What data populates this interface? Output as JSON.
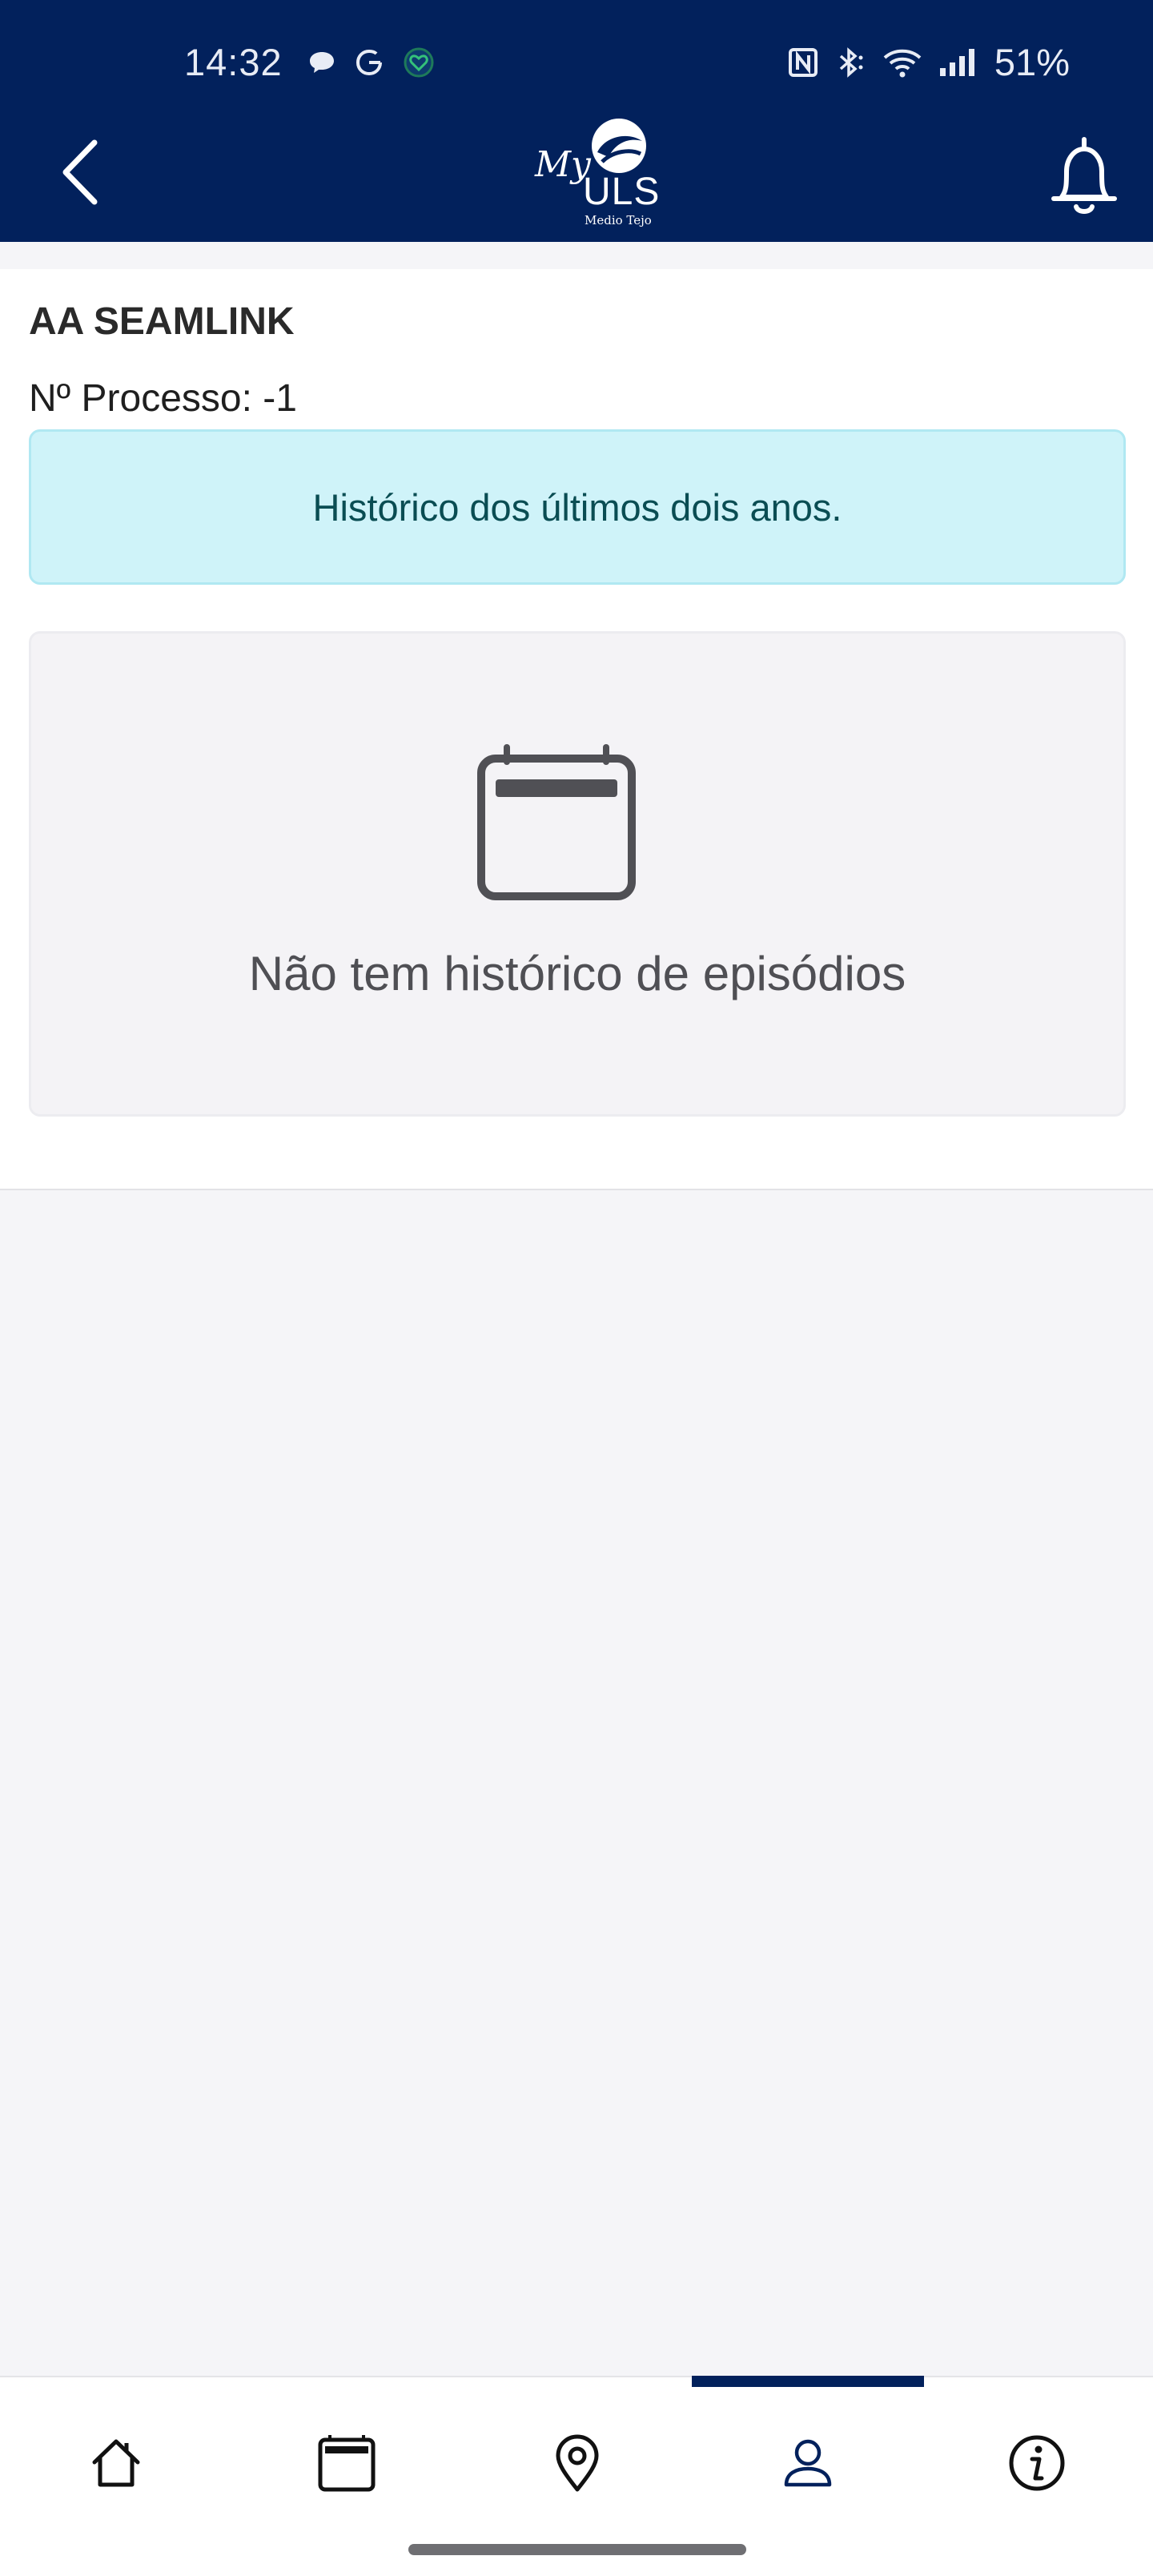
{
  "status_bar": {
    "time": "14:32",
    "battery": "51%",
    "icons": [
      "chat-bubble-icon",
      "google-icon",
      "heart-icon",
      "nfc-icon",
      "bluetooth-icon",
      "wifi-icon",
      "signal-icon"
    ]
  },
  "header": {
    "logo_my": "My",
    "logo_uls": "ULS",
    "logo_sub": "Medio Tejo",
    "back_icon": "chevron-left-icon",
    "bell_icon": "bell-icon",
    "background": "#02215c"
  },
  "patient": {
    "name": "AA SEAMLINK",
    "process": "Nº Processo: -1"
  },
  "alert": {
    "text": "Histórico dos últimos dois anos.",
    "background": "#cff3f9"
  },
  "empty_state": {
    "icon": "calendar-icon",
    "text": "Não tem histórico de episódios"
  },
  "tabbar": {
    "tabs": [
      {
        "icon": "home-icon"
      },
      {
        "icon": "calendar-icon"
      },
      {
        "icon": "location-pin-icon"
      },
      {
        "icon": "person-icon",
        "active": true
      },
      {
        "icon": "info-icon"
      }
    ],
    "active_color": "#02215c"
  }
}
